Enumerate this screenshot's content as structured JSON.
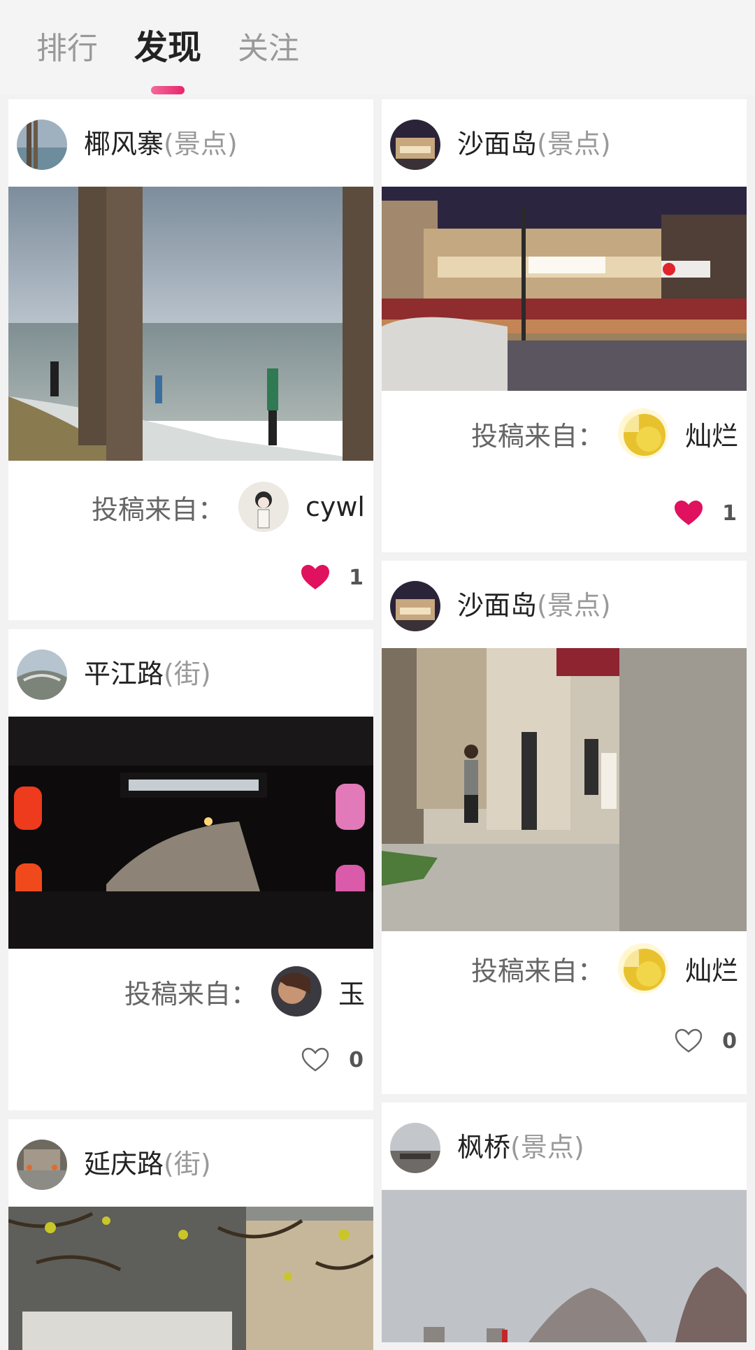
{
  "tabs": [
    {
      "label": "排行",
      "active": false
    },
    {
      "label": "发现",
      "active": true
    },
    {
      "label": "关注",
      "active": false
    }
  ],
  "submit_label": "投稿来自：",
  "cards": [
    {
      "place": "椰风寨",
      "kind": "(景点)",
      "submitter": "cywl",
      "likes": "1",
      "liked": true
    },
    {
      "place": "平江路",
      "kind": "(街)",
      "submitter": "玉",
      "likes": "0",
      "liked": false
    },
    {
      "place": "延庆路",
      "kind": "(街)"
    },
    {
      "place": "沙面岛",
      "kind": "(景点)",
      "submitter": "灿烂",
      "likes": "1",
      "liked": true
    },
    {
      "place": "沙面岛",
      "kind": "(景点)",
      "submitter": "灿烂",
      "likes": "0",
      "liked": false
    },
    {
      "place": "枫桥",
      "kind": "(景点)"
    }
  ],
  "colors": {
    "accent": "#e0115f",
    "muted": "#999999"
  }
}
